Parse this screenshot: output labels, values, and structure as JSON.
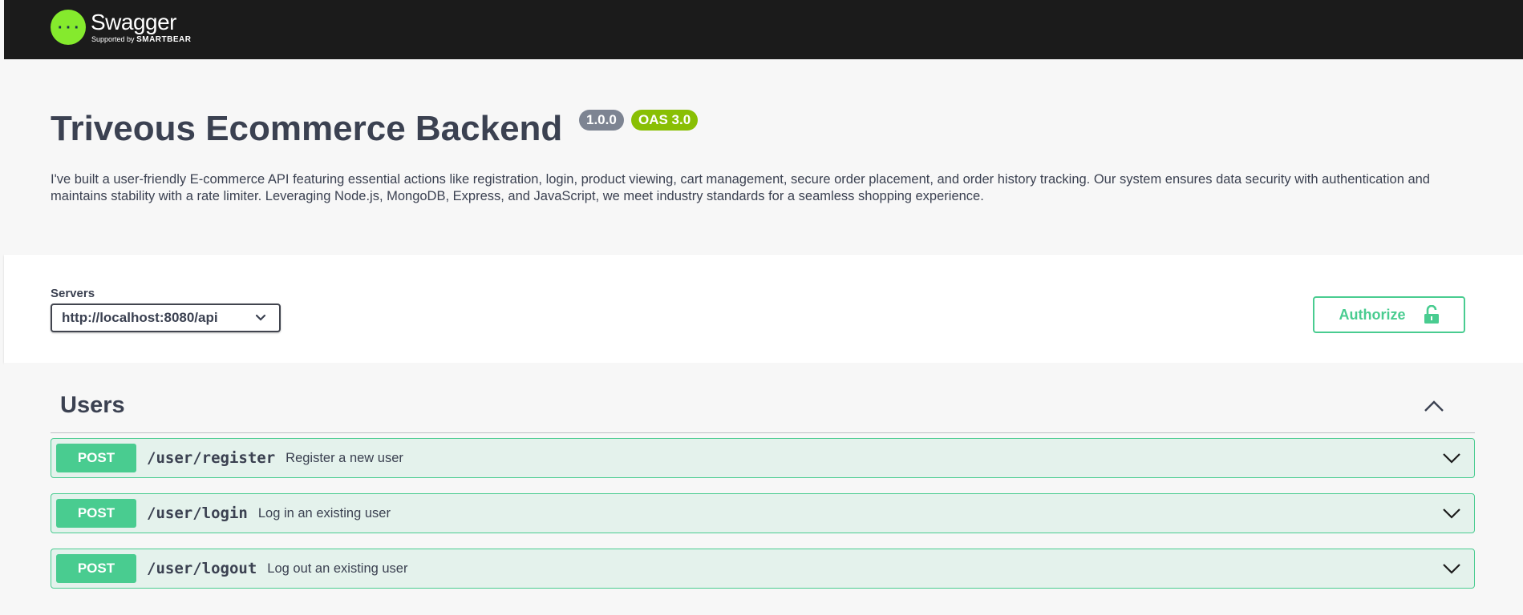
{
  "topbar": {
    "logo_name": "Swagger",
    "logo_trademark": ".",
    "logo_sub_prefix": "Supported by",
    "logo_sub_brand": "SMARTBEAR",
    "logo_icon": "swagger-curly-braces-icon"
  },
  "info": {
    "title": "Triveous Ecommerce Backend",
    "version": "1.0.0",
    "oas": "OAS 3.0",
    "description": "I've built a user-friendly E-commerce API featuring essential actions like registration, login, product viewing, cart management, secure order placement, and order history tracking. Our system ensures data security with authentication and maintains stability with a rate limiter. Leveraging Node.js, MongoDB, Express, and JavaScript, we meet industry standards for a seamless shopping experience."
  },
  "servers": {
    "label": "Servers",
    "selected": "http://localhost:8080/api"
  },
  "authorize": {
    "label": "Authorize",
    "icon": "unlocked-lock-icon"
  },
  "tag": {
    "title": "Users",
    "toggle_icon": "chevron-up-icon"
  },
  "operations": [
    {
      "method": "POST",
      "path": "/user/register",
      "summary": "Register a new user"
    },
    {
      "method": "POST",
      "path": "/user/login",
      "summary": "Log in an existing user"
    },
    {
      "method": "POST",
      "path": "/user/logout",
      "summary": "Log out an existing user"
    }
  ],
  "colors": {
    "topbar_bg": "#1b1b1b",
    "logo_green": "#85ea2d",
    "post_green": "#49cc90",
    "version_badge": "#7d8492",
    "oas_badge": "#89bf04",
    "text": "#3b4151"
  }
}
